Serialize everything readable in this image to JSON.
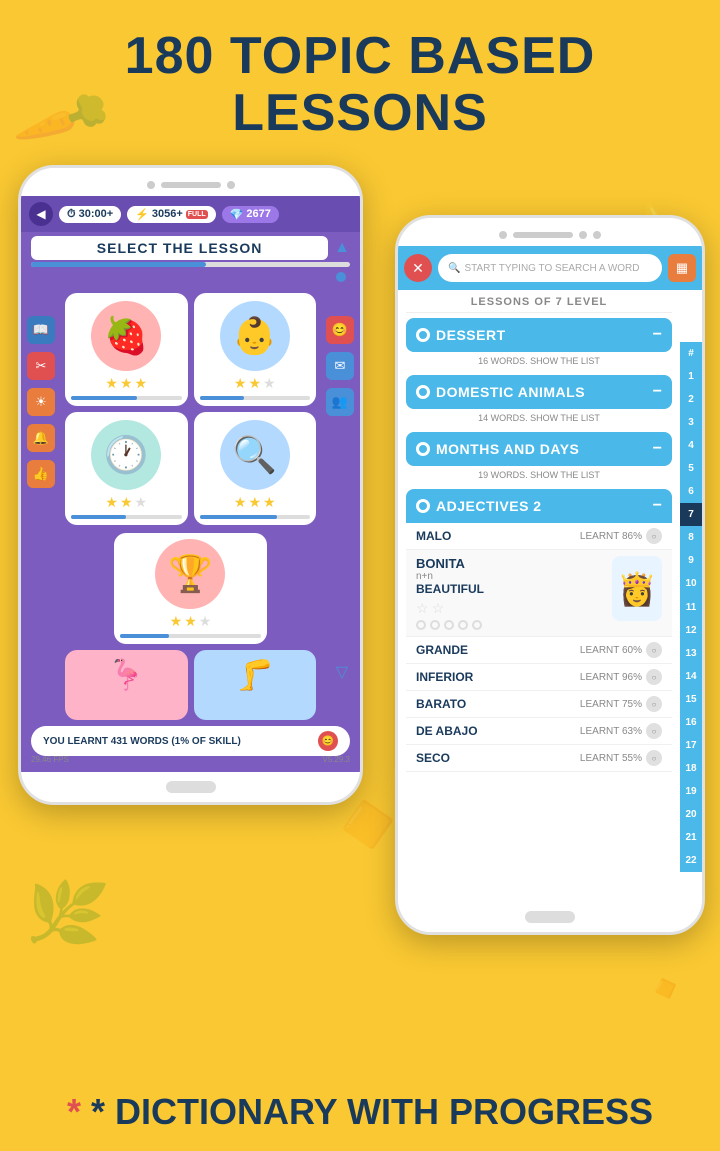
{
  "page": {
    "background_color": "#F9C832",
    "main_title": "180 TOPIC BASED LESSONS",
    "footer_text": "* DICTIONARY WITH PROGRESS"
  },
  "left_phone": {
    "status": {
      "time": "30:00+",
      "lightning": "3056+",
      "full_tag": "FULL",
      "gems": "2677"
    },
    "header": "SELECT THE LESSON",
    "lessons": [
      {
        "icon": "🍓",
        "color": "red",
        "stars": 3,
        "progress": 60
      },
      {
        "icon": "👶",
        "color": "blue",
        "stars": 2,
        "progress": 40
      },
      {
        "icon": "🕐",
        "color": "teal",
        "stars": 2,
        "progress": 50
      },
      {
        "icon": "🔍",
        "color": "blue",
        "stars": 3,
        "progress": 70
      },
      {
        "icon": "🏆",
        "color": "red",
        "stars": 2,
        "progress": 35
      }
    ],
    "bottom_partial": [
      {
        "icon": "🦩",
        "color": "pink"
      },
      {
        "icon": "🦵",
        "color": "blue"
      }
    ],
    "learnt_bar": "YOU LEARNT 431 WORDS (1% OF SKILL)",
    "fps": "29.46 FPS",
    "version": "V5.29.3"
  },
  "right_phone": {
    "search_placeholder": "START TYPING TO SEARCH A WORD",
    "level_header": "LESSONS OF 7 LEVEL",
    "lessons": [
      {
        "title": "DESSERT",
        "sub": "16 WORDS. SHOW THE LIST",
        "expanded": false
      },
      {
        "title": "DOMESTIC ANIMALS",
        "sub": "14 WORDS. SHOW THE LIST",
        "expanded": false
      },
      {
        "title": "MONTHS AND DAYS",
        "sub": "19 WORDS. SHOW THE LIST",
        "expanded": false
      }
    ],
    "adjectives": {
      "title": "ADJECTIVES 2",
      "words": [
        {
          "name": "MALO",
          "learnt": "LEARNT 86%"
        },
        {
          "name": "BONITA",
          "translation": "n+n",
          "meaning": "BEAUTIFUL",
          "expanded": true
        },
        {
          "name": "GRANDE",
          "learnt": "LEARNT 60%"
        },
        {
          "name": "INFERIOR",
          "learnt": "LEARNT 96%"
        },
        {
          "name": "BARATO",
          "learnt": "LEARNT 75%"
        },
        {
          "name": "DE ABAJO",
          "learnt": "LEARNT 63%"
        },
        {
          "name": "SECO",
          "learnt": "LEARNT 55%"
        }
      ]
    },
    "numbers": [
      "#",
      "1",
      "2",
      "3",
      "4",
      "5",
      "6",
      "7",
      "8",
      "9",
      "10",
      "11",
      "12",
      "13",
      "14",
      "15",
      "16",
      "17",
      "18",
      "19",
      "20",
      "21",
      "22"
    ],
    "active_number": "7"
  }
}
